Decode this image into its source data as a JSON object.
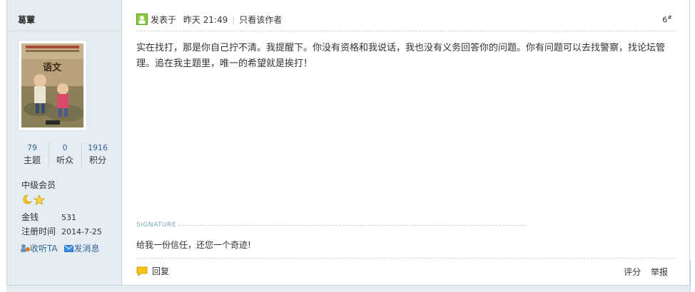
{
  "author": {
    "name": "葛蕈"
  },
  "stats": [
    {
      "value": "79",
      "label": "主题"
    },
    {
      "value": "0",
      "label": "听众"
    },
    {
      "value": "1916",
      "label": "积分"
    }
  ],
  "level": "中级会员",
  "info": {
    "money_key": "金钱",
    "money_val": "531",
    "reg_key": "注册时间",
    "reg_val": "2014-7-25"
  },
  "actions": {
    "follow": "收听TA",
    "message": "发消息"
  },
  "avatar_text": {
    "title": "语文"
  },
  "post": {
    "posted_at_prefix": "发表于",
    "posted_at": "昨天 21:49",
    "only_author": "只看该作者",
    "floor": "6",
    "floor_mark": "#",
    "content": "实在找打，那是你自己拧不清。我提醒下。你没有资格和我说话，我也没有义务回答你的问题。你有问题可以去找警察，找论坛管理。追在我主题里，唯一的希望就是挨打！",
    "signature_label": "SIGNATURE",
    "signature": "给我一份信任，还您一个奇迹!"
  },
  "footer": {
    "reply": "回复",
    "rate": "评分",
    "report": "举报"
  },
  "colors": {
    "sidebar_bg": "#e5edf2",
    "border": "#c2d5e3",
    "link": "#336699"
  }
}
